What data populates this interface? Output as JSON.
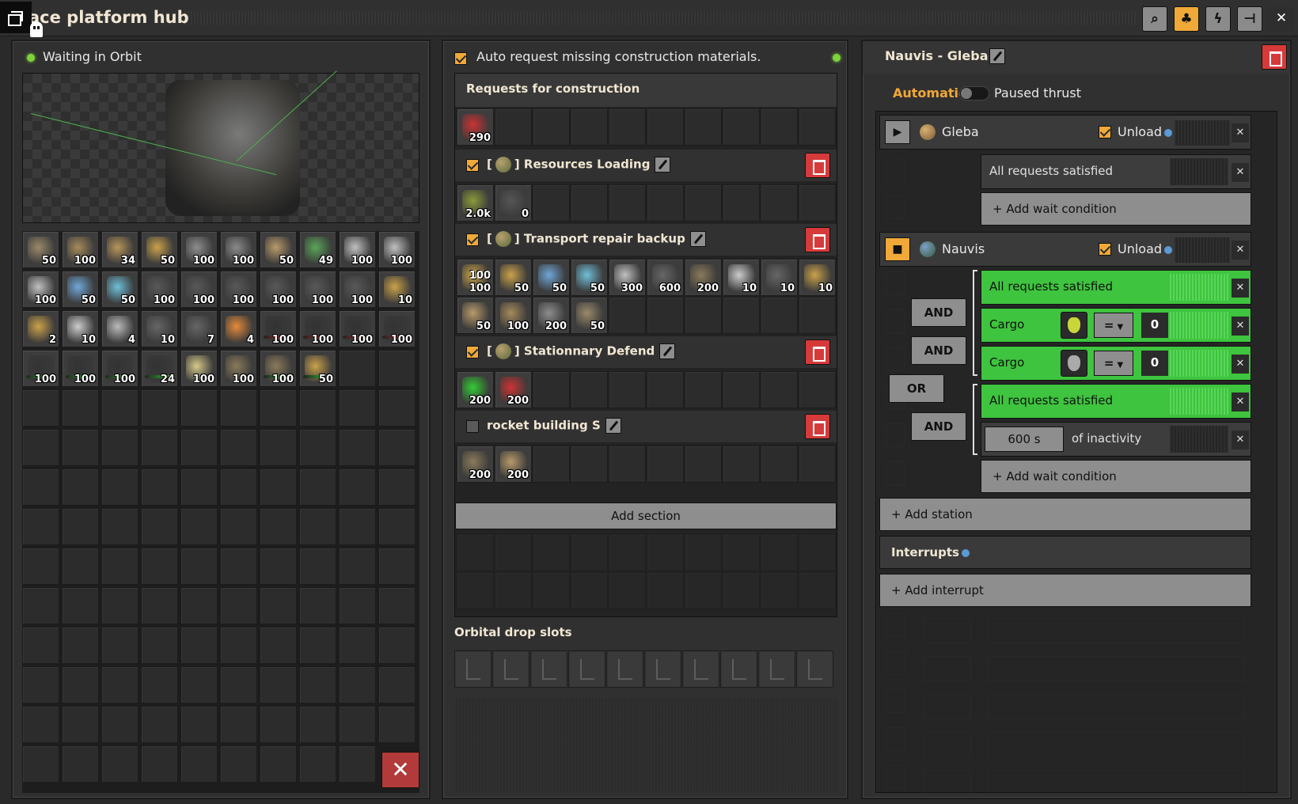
{
  "window": {
    "title": "ace platform hub"
  },
  "toolbar": [
    "search-icon",
    "tree-icon",
    "lightning-icon",
    "pin-icon",
    "close-icon"
  ],
  "left": {
    "status": "Waiting in Orbit",
    "inventory": [
      [
        "50",
        "100",
        "34",
        "50",
        "100",
        "100",
        "50",
        "49",
        "100",
        "100"
      ],
      [
        "100",
        "50",
        "50",
        "100",
        "100",
        "100",
        "100",
        "100",
        "100",
        "10"
      ],
      [
        "2",
        "10",
        "4",
        "10",
        "7",
        "4",
        "100",
        "100",
        "100",
        "100"
      ],
      [
        "100",
        "100",
        "100",
        "24",
        "100",
        "100",
        "100",
        "50"
      ]
    ],
    "trash_label": "✕"
  },
  "middle": {
    "auto_request_label": "Auto request missing construction materials.",
    "requests_title": "Requests for construction",
    "first_row_count": "290",
    "sections": [
      {
        "title": "] Resources Loading",
        "prefix": "[",
        "enabled": true,
        "rows": [
          [
            "2.0k",
            "0"
          ]
        ]
      },
      {
        "title": "] Transport repair backup",
        "prefix": "[",
        "enabled": true,
        "rows": [
          [
            "100",
            "50",
            "50",
            "50",
            "300",
            "600",
            "200",
            "10",
            "10",
            "10"
          ],
          [
            "50",
            "100",
            "200",
            "50"
          ]
        ],
        "row1_top": "100"
      },
      {
        "title": "] Stationnary Defend",
        "prefix": "[",
        "enabled": true,
        "rows": [
          [
            "200",
            "200"
          ]
        ]
      },
      {
        "title": "rocket building S",
        "prefix": "",
        "enabled": false,
        "rows": [
          [
            "200",
            "200"
          ]
        ]
      }
    ],
    "add_section_label": "Add section",
    "orbital_title": "Orbital drop slots"
  },
  "right": {
    "schedule_title": "Nauvis - Gleba I",
    "automatic_label": "Automatic",
    "paused_label": "Paused thrust",
    "stations": [
      {
        "name": "Gleba",
        "unload_label": "Unload"
      },
      {
        "name": "Nauvis",
        "unload_label": "Unload"
      }
    ],
    "cond_all_requests": "All requests satisfied",
    "add_wait": "+ Add wait condition",
    "and_label": "AND",
    "or_label": "OR",
    "cargo_label": "Cargo",
    "eq_label": "=",
    "zero_label": "0",
    "inactivity_value": "600 s",
    "inactivity_label": "of inactivity",
    "add_station": "+ Add station",
    "interrupts_label": "Interrupts",
    "add_interrupt": "+ Add interrupt"
  },
  "colors": {
    "accent": "#f0a838",
    "green": "#3ec43e",
    "red": "#d63a3a"
  }
}
